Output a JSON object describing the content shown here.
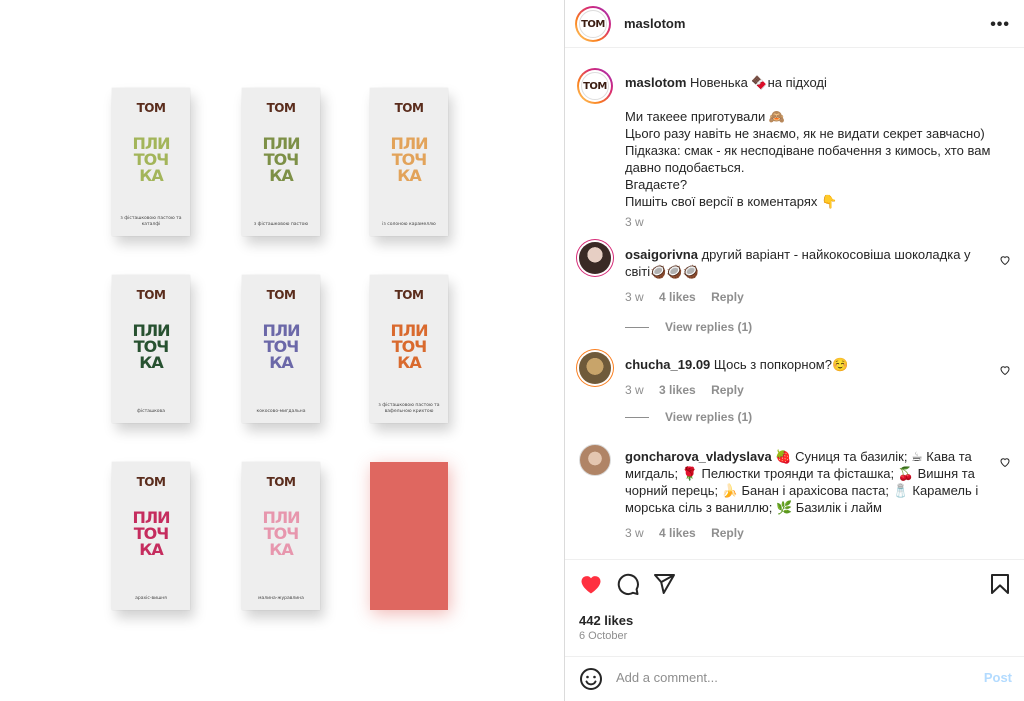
{
  "media": {
    "brand": "TOM",
    "bars": [
      {
        "word": [
          "ПЛИ",
          "ТОЧ",
          "КА"
        ],
        "color": "#a3b55a",
        "desc": "з фісташковою пастою та каталфі"
      },
      {
        "word": [
          "ПЛИ",
          "ТОЧ",
          "КА"
        ],
        "color": "#7d9047",
        "desc": "з фісташковою пастою"
      },
      {
        "word": [
          "ПЛИ",
          "ТОЧ",
          "КА"
        ],
        "color": "#e2a35a",
        "desc": "із солоною карамеллю"
      },
      {
        "word": [
          "ПЛИ",
          "ТОЧ",
          "КА"
        ],
        "color": "#275130",
        "desc": "фісташкова"
      },
      {
        "word": [
          "ПЛИ",
          "ТОЧ",
          "КА"
        ],
        "color": "#6b68a8",
        "desc": "кокосово-мигдальна"
      },
      {
        "word": [
          "ПЛИ",
          "ТОЧ",
          "КА"
        ],
        "color": "#d96a2e",
        "desc": "з фісташковою пастою та вафельною крихтою"
      },
      {
        "word": [
          "ПЛИ",
          "ТОЧ",
          "КА"
        ],
        "color": "#c52c5e",
        "desc": "арахіс-вишня"
      },
      {
        "word": [
          "ПЛИ",
          "ТОЧ",
          "КА"
        ],
        "color": "#e796ad",
        "desc": "малина-журавлина"
      }
    ],
    "solid_color": "#df6760"
  },
  "header": {
    "avatar_text": "TOM",
    "username": "maslotom",
    "more_label": "•••"
  },
  "caption": {
    "username": "maslotom",
    "line1": "Новенька 🍫на підході",
    "lines": [
      "Ми такеее приготували 🙈",
      "Цього разу навіть не знаємо, як не видати секрет завчасно)",
      "Підказка: смак - як несподіване побачення з кимось, хто вам давно подобається.",
      "Вгадаєте?",
      "Пишіть свої версії в коментарях 👇"
    ],
    "time": "3 w"
  },
  "comments": [
    {
      "username": "osaigorivna",
      "text": "другий варіант - найкокосовіша шоколадка у світі🥥🥥🥥",
      "time": "3 w",
      "likes": "4 likes",
      "reply": "Reply",
      "view_replies": "View replies (1)"
    },
    {
      "username": "chucha_19.09",
      "text": "Щось з попкорном?☺️",
      "time": "3 w",
      "likes": "3 likes",
      "reply": "Reply",
      "view_replies": "View replies (1)"
    },
    {
      "username": "goncharova_vladyslava",
      "text": "🍓 Суниця та базилік; ☕ Кава та мигдаль; 🌹 Пелюстки троянди та фісташка; 🍒 Вишня та чорний перець; 🍌 Банан і арахісова паста; 🧂 Карамель і морська сіль з ваниллю; 🌿 Базилік і лайм",
      "time": "3 w",
      "likes": "4 likes",
      "reply": "Reply"
    }
  ],
  "actions": {
    "likes": "442 likes",
    "date": "6 October"
  },
  "add_comment": {
    "placeholder": "Add a comment...",
    "post_label": "Post"
  },
  "icons": [
    "more-icon",
    "heart-icon",
    "comment-icon",
    "share-icon",
    "bookmark-icon",
    "emoji-icon",
    "like-comment-icon"
  ]
}
